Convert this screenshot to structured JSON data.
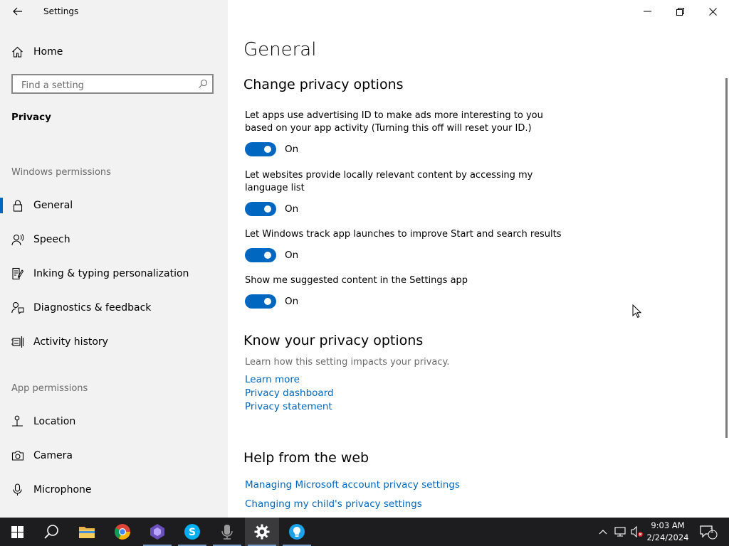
{
  "app": {
    "title": "Settings"
  },
  "sidebar": {
    "home_label": "Home",
    "search_placeholder": "Find a setting",
    "section_title": "Privacy",
    "windows_permissions_label": "Windows permissions",
    "windows_items": [
      {
        "label": "General",
        "icon": "lock-icon",
        "active": true
      },
      {
        "label": "Speech",
        "icon": "speech-icon"
      },
      {
        "label": "Inking & typing personalization",
        "icon": "inking-icon"
      },
      {
        "label": "Diagnostics & feedback",
        "icon": "diagnostics-icon"
      },
      {
        "label": "Activity history",
        "icon": "activity-history-icon"
      }
    ],
    "app_permissions_label": "App permissions",
    "app_items": [
      {
        "label": "Location",
        "icon": "location-icon"
      },
      {
        "label": "Camera",
        "icon": "camera-icon"
      },
      {
        "label": "Microphone",
        "icon": "microphone-icon"
      }
    ]
  },
  "main": {
    "page_title": "General",
    "change_heading": "Change privacy options",
    "settings": [
      {
        "text": "Let apps use advertising ID to make ads more interesting to you based on your app activity (Turning this off will reset your ID.)",
        "state": "On"
      },
      {
        "text": "Let websites provide locally relevant content by accessing my language list",
        "state": "On"
      },
      {
        "text": "Let Windows track app launches to improve Start and search results",
        "state": "On"
      },
      {
        "text": "Show me suggested content in the Settings app",
        "state": "On"
      }
    ],
    "know_heading": "Know your privacy options",
    "know_desc": "Learn how this setting impacts your privacy.",
    "know_links": [
      "Learn more",
      "Privacy dashboard",
      "Privacy statement"
    ],
    "help_heading": "Help from the web",
    "help_links": [
      "Managing Microsoft account privacy settings",
      "Changing my child's privacy settings"
    ]
  },
  "taskbar": {
    "time": "9:03 AM",
    "date": "2/24/2024",
    "notification_count": "1"
  },
  "colors": {
    "accent": "#0067c0",
    "sidebar_bg": "#f2f2f2",
    "taskbar_bg": "#1d1d1f"
  }
}
